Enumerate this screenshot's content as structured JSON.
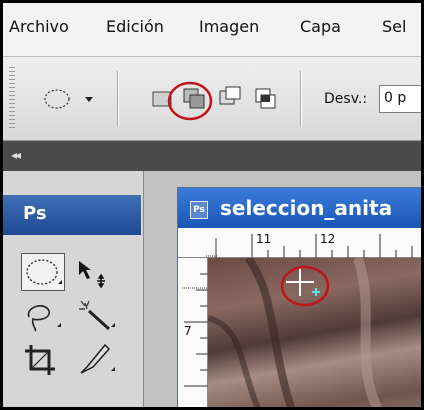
{
  "menu": {
    "items": [
      "Archivo",
      "Edición",
      "Imagen",
      "Capa",
      "Sel"
    ]
  },
  "options": {
    "desv_label": "Desv.:",
    "desv_value": "0 p",
    "highlight_color": "#c0141b",
    "active_mode_icon": "add-to-selection-icon"
  },
  "panel": {
    "collapse_glyph": "◂◂",
    "ps_label": "Ps"
  },
  "document": {
    "title": "seleccion_anita",
    "icon_label": "Ps",
    "ruler_h_marks": [
      "11",
      "12"
    ],
    "ruler_v_marks": [
      "7"
    ]
  },
  "colors": {
    "title_bar": "#1f5cc0",
    "ps_panel": "#2a5aa8",
    "annotation_circle": "#c0141b"
  }
}
